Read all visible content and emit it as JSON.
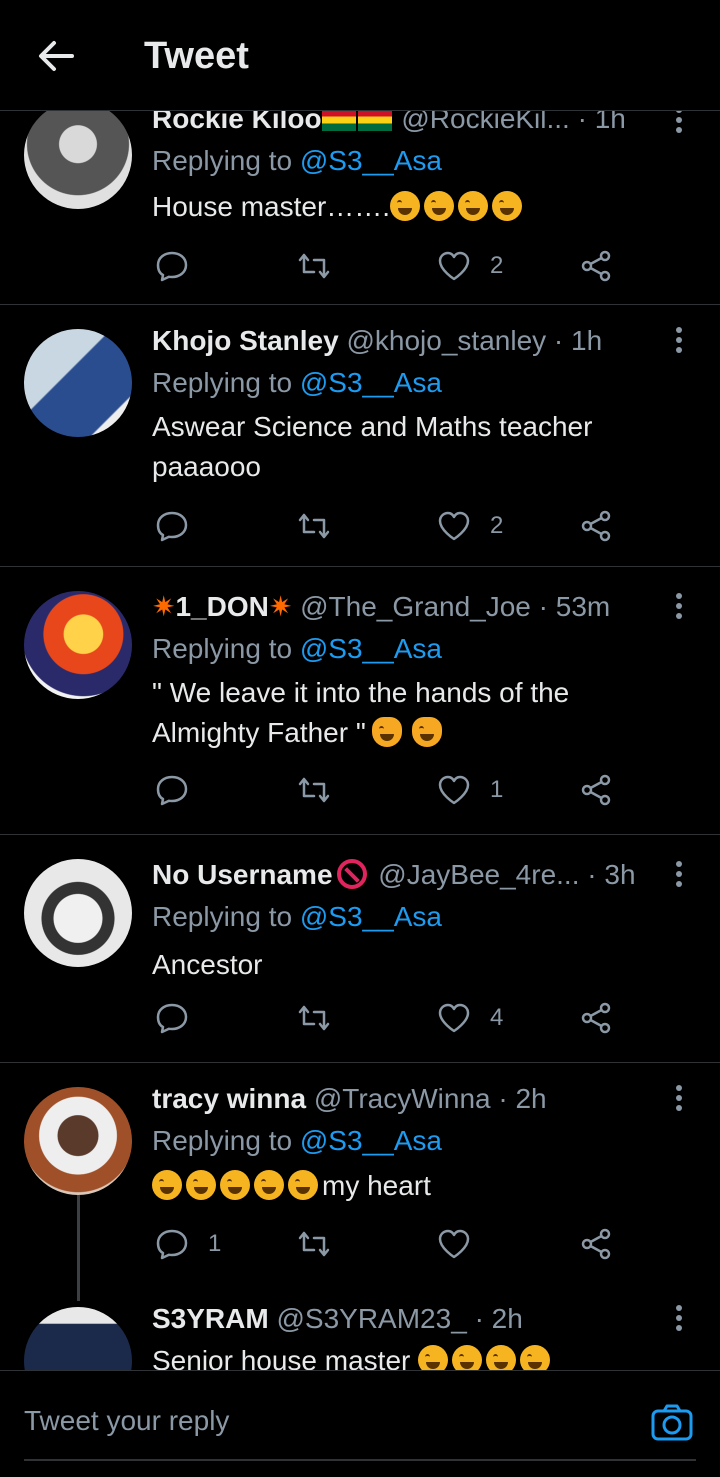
{
  "header": {
    "title": "Tweet",
    "back_icon": "arrow-left-icon"
  },
  "tweets": [
    {
      "display_name": "Rockie Kiloo",
      "handle": "@RockieKil...",
      "time": "· 1h",
      "replying_prefix": "Replying to",
      "replying_to": "@S3__Asa",
      "text": "House master…….",
      "emojis": [
        "rofl-emoji",
        "rofl-emoji",
        "rofl-emoji",
        "rofl-emoji"
      ],
      "reply_count": "",
      "retweet_count": "",
      "like_count": "2"
    },
    {
      "display_name": "Khojo Stanley",
      "handle": "@khojo_stanley",
      "time": "· 1h",
      "replying_prefix": "Replying to",
      "replying_to": "@S3__Asa",
      "text": "Aswear Science and Maths teacher paaaooo",
      "reply_count": "",
      "retweet_count": "",
      "like_count": "2"
    },
    {
      "display_name": "1_DON",
      "handle": "@The_Grand_Joe",
      "time": "· 53m",
      "replying_prefix": "Replying to",
      "replying_to": "@S3__Asa",
      "text": "\" We leave it into the hands of the Almighty Father \"",
      "emojis": [
        "cat-joy-emoji",
        "cat-joy-emoji"
      ],
      "reply_count": "",
      "retweet_count": "",
      "like_count": "1"
    },
    {
      "display_name": "No Username",
      "handle": "@JayBee_4re...",
      "time": "· 3h",
      "replying_prefix": "Replying to",
      "replying_to": "@S3__Asa",
      "text": "Ancestor",
      "reply_count": "",
      "retweet_count": "",
      "like_count": "4"
    },
    {
      "display_name": "tracy winna",
      "handle": "@TracyWinna",
      "time": "· 2h",
      "replying_prefix": "Replying to",
      "replying_to": "@S3__Asa",
      "text": "my heart",
      "emojis": [
        "rofl-emoji",
        "rofl-emoji",
        "rofl-emoji",
        "rofl-emoji",
        "joy-emoji"
      ],
      "reply_count": "1",
      "retweet_count": "",
      "like_count": ""
    },
    {
      "display_name": "S3YRAM",
      "handle": "@S3YRAM23_",
      "time": "· 2h",
      "text": "Senior house master",
      "emojis": [
        "joy-emoji",
        "joy-emoji",
        "joy-emoji",
        "joy-emoji"
      ]
    }
  ],
  "compose": {
    "placeholder": "Tweet your reply",
    "camera_icon": "camera-icon"
  },
  "colors": {
    "background": "#000000",
    "link": "#1d9bf0",
    "muted": "#8b98a5",
    "divider": "#2f3336"
  }
}
